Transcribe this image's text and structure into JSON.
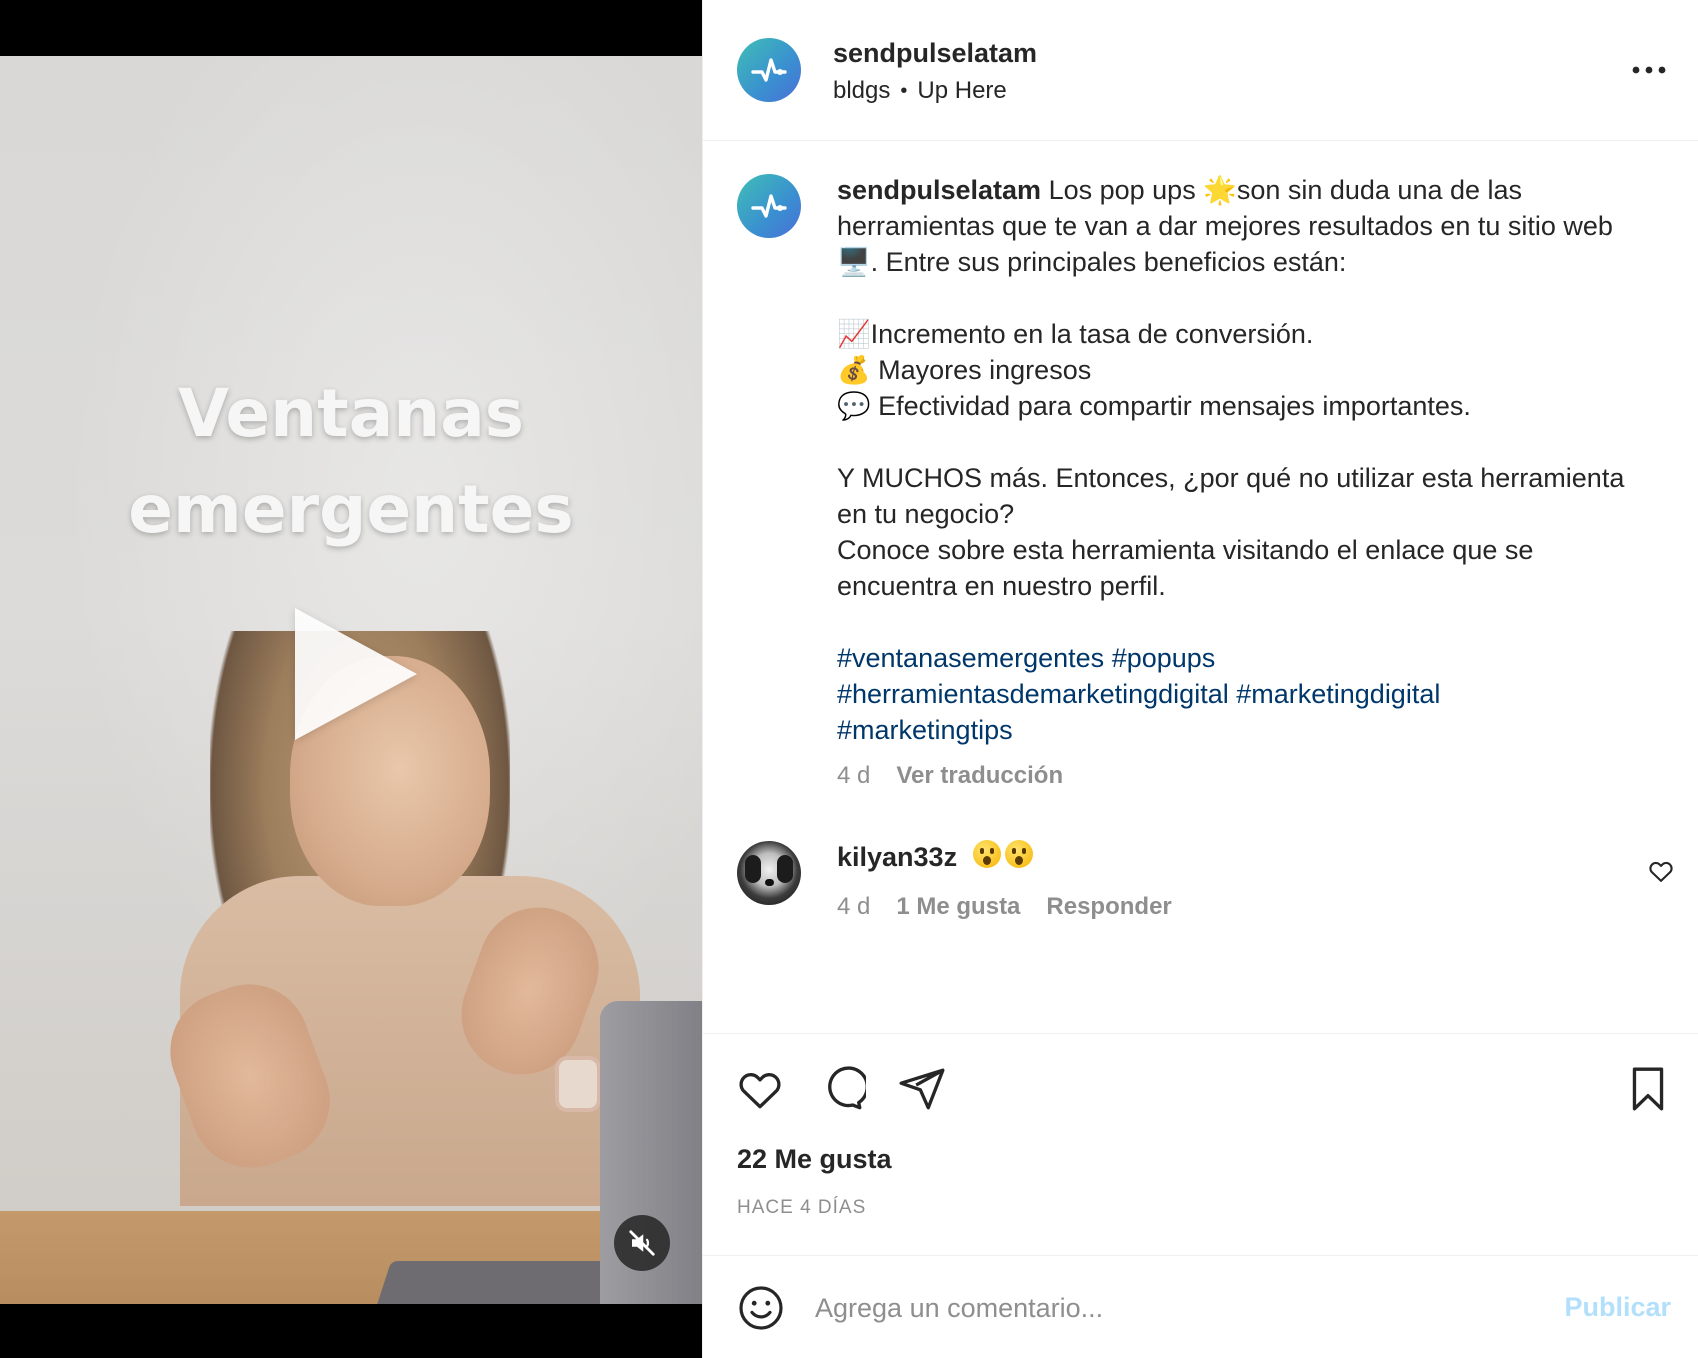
{
  "video": {
    "overlay_line1": "Ventanas",
    "overlay_line2": "emergentes"
  },
  "header": {
    "username": "sendpulselatam",
    "sub_left": "bldgs",
    "sub_right": "Up Here"
  },
  "caption": {
    "username": "sendpulselatam",
    "text": " Los pop ups 🌟son sin duda una de las herramientas que te van a dar mejores resultados en tu sitio web 🖥️. Entre sus principales beneficios están:\n\n📈Incremento en la tasa de conversión.\n💰 Mayores ingresos\n💬 Efectividad para compartir mensajes importantes.\n\nY MUCHOS más. Entonces, ¿por qué no utilizar esta herramienta en tu negocio?\nConoce sobre esta herramienta visitando el enlace que se encuentra en nuestro perfil.",
    "hashtags": [
      "#ventanasemergentes",
      "#popups",
      "#herramientasdemarketingdigital",
      "#marketingdigital",
      "#marketingtips"
    ],
    "age": "4 d",
    "translate_label": "Ver traducción"
  },
  "comment": {
    "username": "kilyan33z",
    "age": "4 d",
    "likes_label": "1 Me gusta",
    "reply_label": "Responder"
  },
  "post": {
    "likes": "22 Me gusta",
    "date": "HACE 4 DÍAS"
  },
  "comment_box": {
    "placeholder": "Agrega un comentario...",
    "publish_label": "Publicar"
  },
  "colors": {
    "hashtag": "#00376b",
    "muted": "#8e8e8e",
    "publish_disabled": "#b2dffc"
  }
}
